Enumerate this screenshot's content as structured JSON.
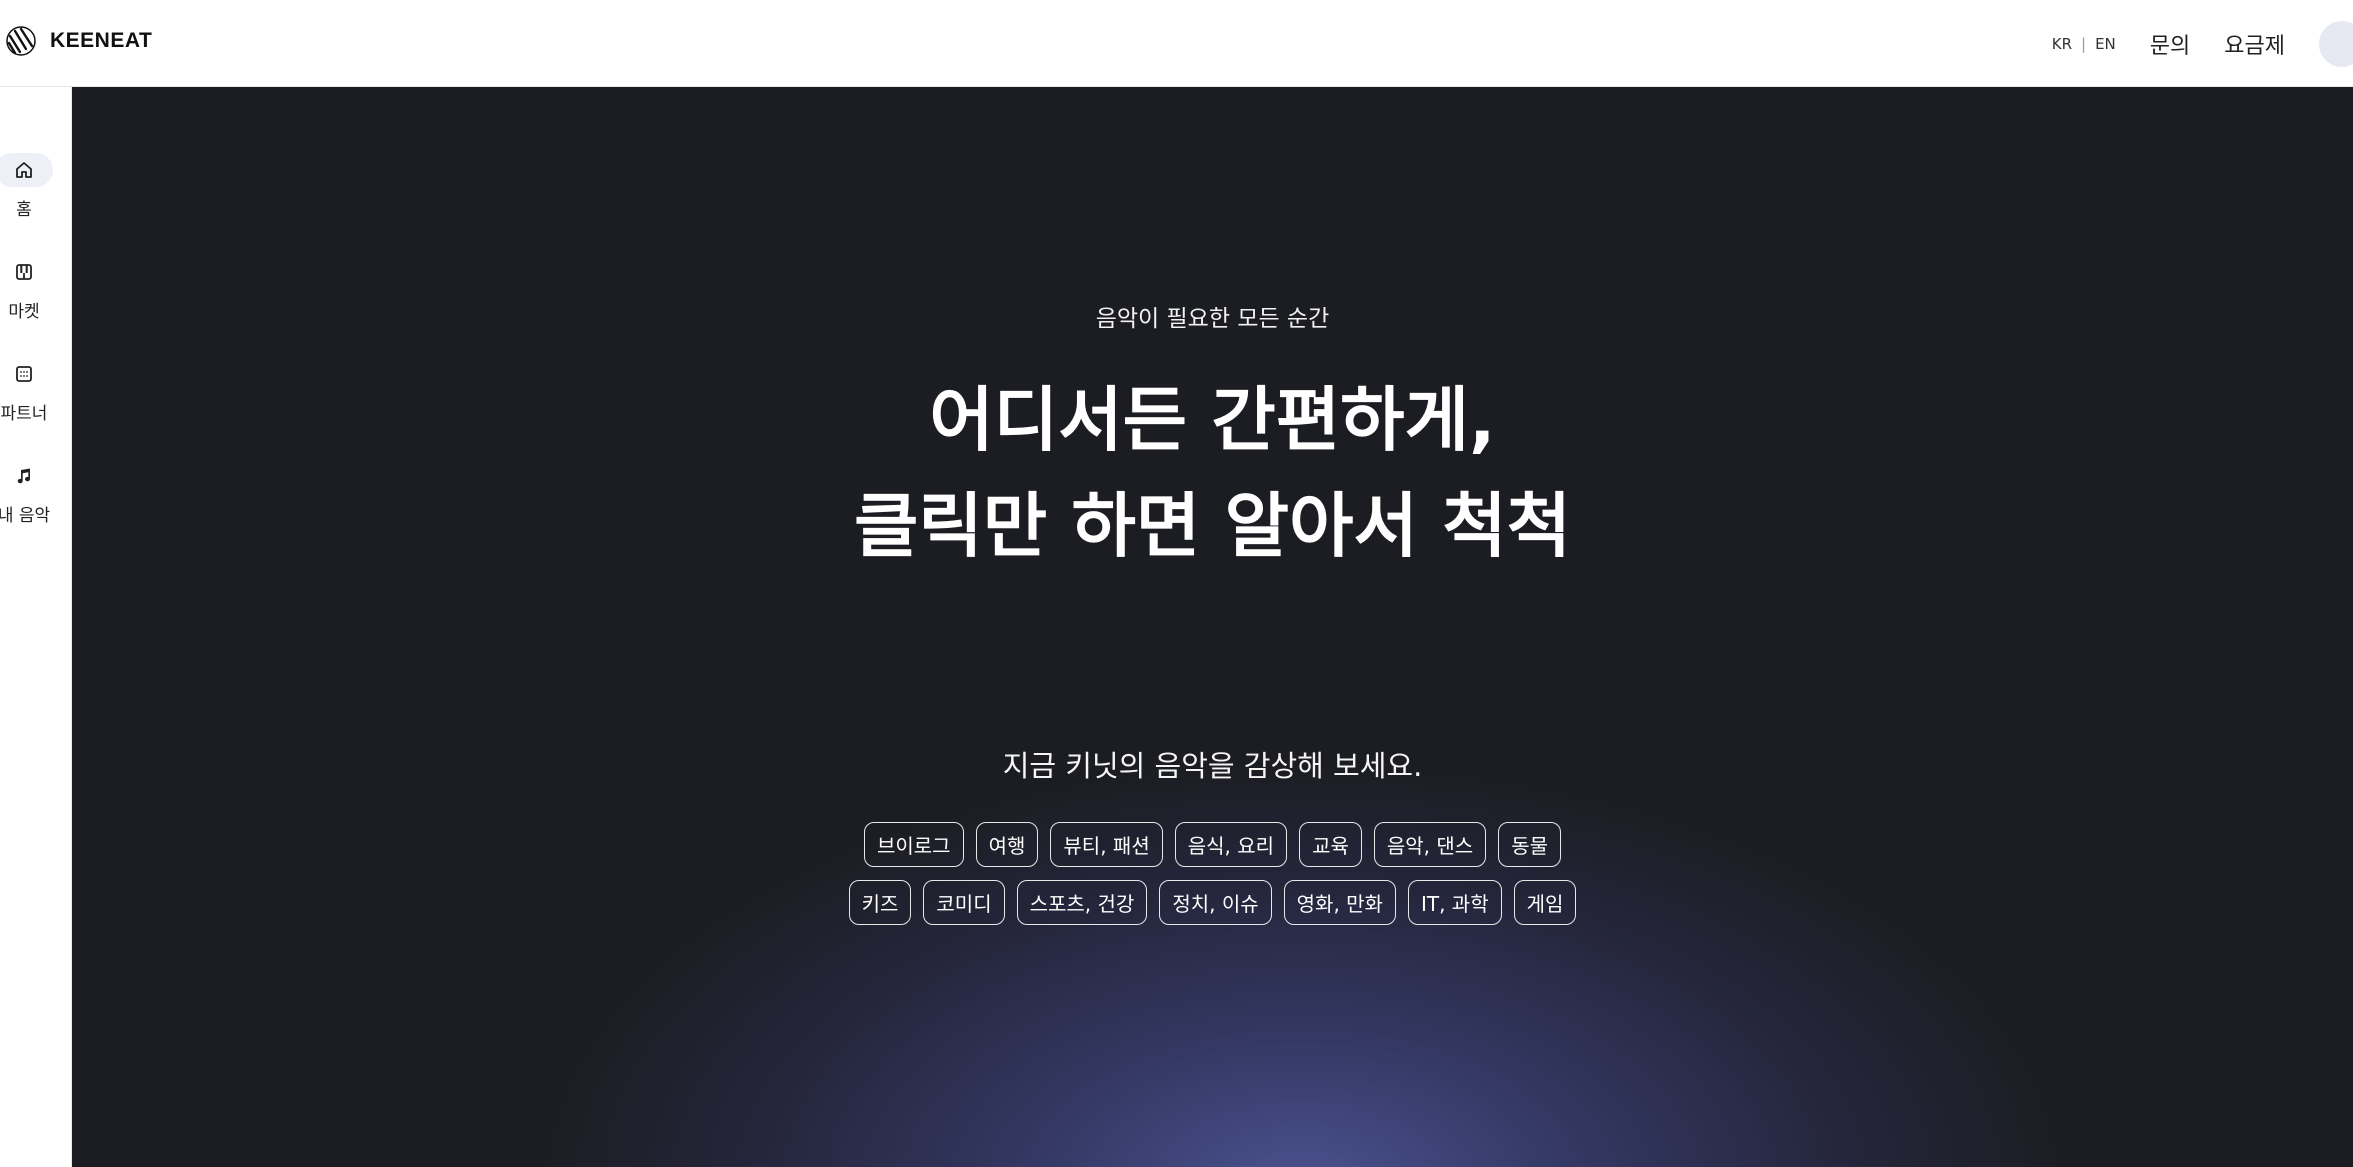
{
  "header": {
    "brand": "KEENEAT",
    "lang_kr": "KR",
    "lang_sep": "|",
    "lang_en": "EN",
    "nav": [
      "문의",
      "요금제"
    ]
  },
  "sidebar": {
    "items": [
      {
        "label": "홈",
        "icon": "home-icon"
      },
      {
        "label": "마켓",
        "icon": "piano-keys-icon"
      },
      {
        "label": "파트너",
        "icon": "partner-grid-icon"
      },
      {
        "label": "내 음악",
        "icon": "music-note-icon"
      }
    ]
  },
  "hero": {
    "eyebrow": "음악이 필요한 모든 순간",
    "title_line1": "어디서든 간편하게,",
    "title_line2": "클릭만 하면 알아서 척척",
    "subtitle": "지금 키닛의 음악을 감상해 보세요."
  },
  "categories": {
    "row1": [
      "브이로그",
      "여행",
      "뷰티, 패션",
      "음식, 요리",
      "교육",
      "음악, 댄스",
      "동물"
    ],
    "row2": [
      "키즈",
      "코미디",
      "스포츠, 건강",
      "정치, 이슈",
      "영화, 만화",
      "IT, 과학",
      "게임"
    ]
  },
  "colors": {
    "hero_bg": "#1c1d22",
    "hero_glow": "#4a5290",
    "sidebar_active_bg": "#eef0f8"
  }
}
